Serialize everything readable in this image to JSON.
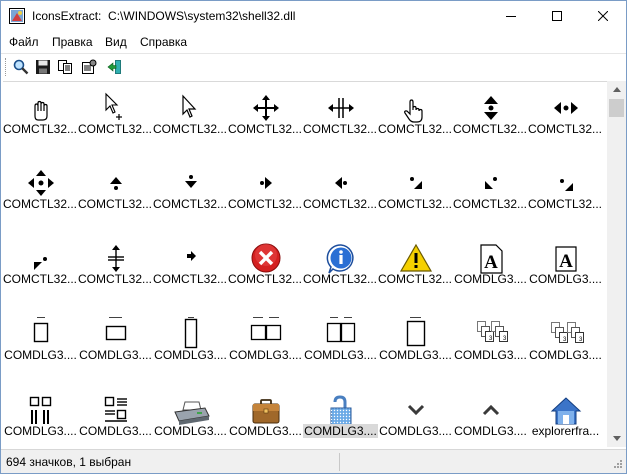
{
  "window": {
    "app_name": "IconsExtract:",
    "file_path": "C:\\WINDOWS\\system32\\shell32.dll"
  },
  "menu": [
    "Файл",
    "Правка",
    "Вид",
    "Справка"
  ],
  "toolbar": [
    "find-icon",
    "save-icon",
    "copy-icon",
    "properties-icon",
    "exit-icon"
  ],
  "icons": [
    {
      "label": "COMCTL32....",
      "icon": "hand-cursor"
    },
    {
      "label": "COMCTL32....",
      "icon": "arrow-plus-cursor"
    },
    {
      "label": "COMCTL32....",
      "icon": "arrow-cursor"
    },
    {
      "label": "COMCTL32....",
      "icon": "move-cursor"
    },
    {
      "label": "COMCTL32....",
      "icon": "split-horizontal-cursor"
    },
    {
      "label": "COMCTL32....",
      "icon": "hand-pointer-cursor"
    },
    {
      "label": "COMCTL32....",
      "icon": "scroll-ns-icon"
    },
    {
      "label": "COMCTL32....",
      "icon": "scroll-ew-icon"
    },
    {
      "label": "COMCTL32....",
      "icon": "scroll-all-icon"
    },
    {
      "label": "COMCTL32....",
      "icon": "scroll-n-icon"
    },
    {
      "label": "COMCTL32....",
      "icon": "scroll-s-icon"
    },
    {
      "label": "COMCTL32....",
      "icon": "scroll-e-icon"
    },
    {
      "label": "COMCTL32....",
      "icon": "scroll-w-icon"
    },
    {
      "label": "COMCTL32....",
      "icon": "scroll-se-icon"
    },
    {
      "label": "COMCTL32....",
      "icon": "scroll-sw-icon"
    },
    {
      "label": "COMCTL32....",
      "icon": "scroll-ne-icon"
    },
    {
      "label": "COMCTL32....",
      "icon": "scroll-nw-icon"
    },
    {
      "label": "COMCTL32....",
      "icon": "split-vertical-cursor"
    },
    {
      "label": "COMCTL32....",
      "icon": "small-arrow-icon"
    },
    {
      "label": "COMCTL32....",
      "icon": "error-icon"
    },
    {
      "label": "COMCTL32....",
      "icon": "info-icon"
    },
    {
      "label": "COMCTL32....",
      "icon": "warning-icon"
    },
    {
      "label": "COMDLG3....",
      "icon": "font-a-icon"
    },
    {
      "label": "COMDLG3....",
      "icon": "font-a-outline-icon"
    },
    {
      "label": "COMDLG3....",
      "icon": "page-portrait-icon"
    },
    {
      "label": "COMDLG3....",
      "icon": "page-landscape-icon"
    },
    {
      "label": "COMDLG3....",
      "icon": "page-tall-icon"
    },
    {
      "label": "COMDLG3....",
      "icon": "page-booklet-icon"
    },
    {
      "label": "COMDLG3....",
      "icon": "page-booklet-open-icon"
    },
    {
      "label": "COMDLG3....",
      "icon": "page-text-icon"
    },
    {
      "label": "COMDLG3....",
      "icon": "collate-pages-icon"
    },
    {
      "label": "COMDLG3....",
      "icon": "collate-pages-alt-icon"
    },
    {
      "label": "COMDLG3....",
      "icon": "layout-grid-icon"
    },
    {
      "label": "COMDLG3....",
      "icon": "layout-list-icon"
    },
    {
      "label": "COMDLG3....",
      "icon": "printer-icon"
    },
    {
      "label": "COMDLG3....",
      "icon": "briefcase-icon"
    },
    {
      "label": "COMDLG3....",
      "icon": "unlocked-padlock-icon"
    },
    {
      "label": "COMDLG3....",
      "icon": "chevron-down-icon"
    },
    {
      "label": "COMDLG3....",
      "icon": "chevron-up-icon"
    },
    {
      "label": "explorerfra...",
      "icon": "home-icon"
    }
  ],
  "selected_index": 36,
  "status": "694 значков, 1 выбран"
}
